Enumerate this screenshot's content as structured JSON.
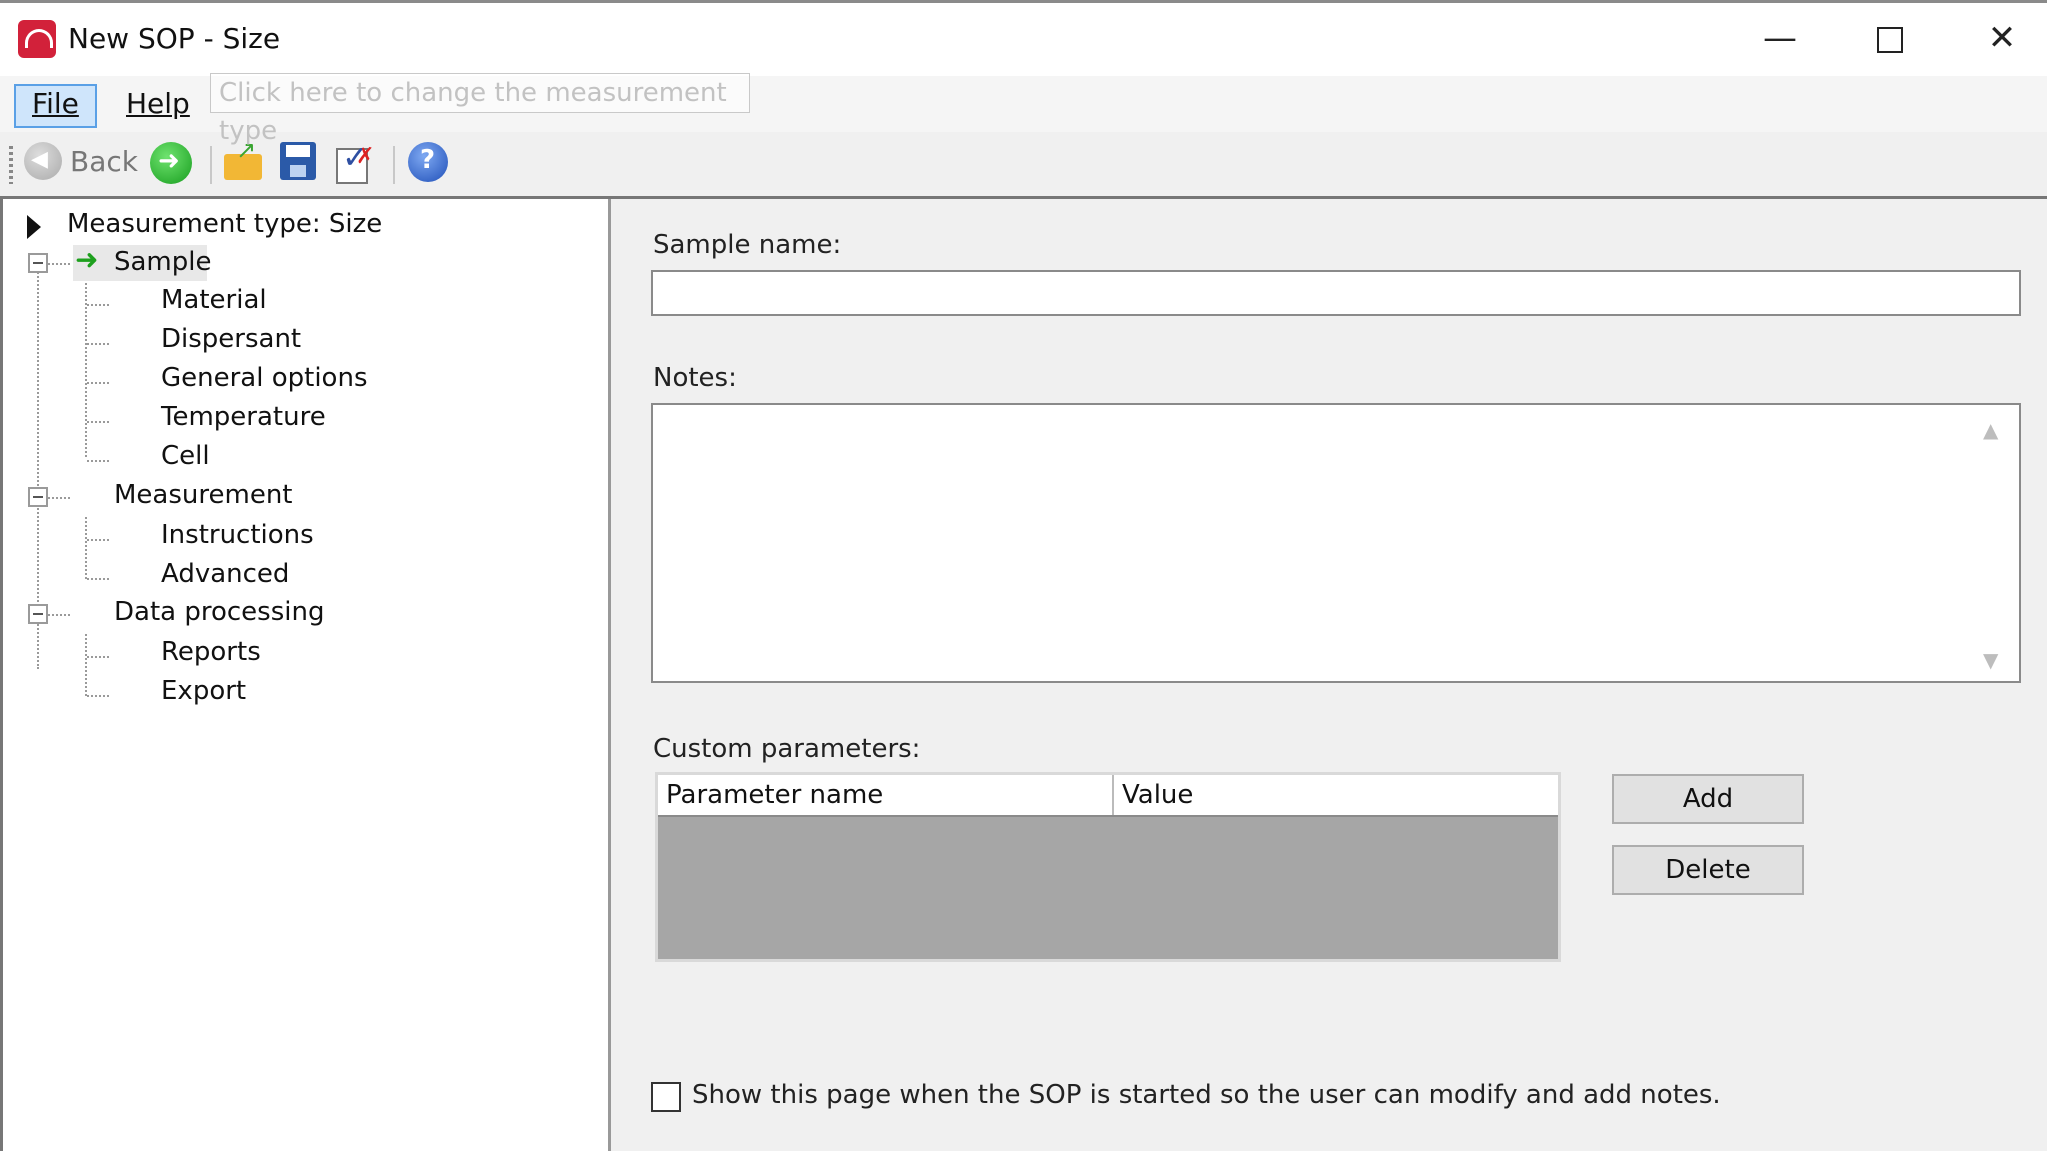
{
  "window": {
    "title": "New SOP - Size",
    "brand_color": "#d2213a"
  },
  "menu": {
    "file": "File",
    "help": "Help"
  },
  "toolbar": {
    "back_label": "Back"
  },
  "tree": {
    "root": "Measurement type: Size",
    "tooltip": "Click here to change the measurement type",
    "groups": [
      {
        "label": "Sample",
        "selected": true,
        "children": [
          "Material",
          "Dispersant",
          "General options",
          "Temperature",
          "Cell"
        ]
      },
      {
        "label": "Measurement",
        "children": [
          "Instructions",
          "Advanced"
        ]
      },
      {
        "label": "Data processing",
        "children": [
          "Reports",
          "Export"
        ]
      }
    ]
  },
  "form": {
    "sample_name_label": "Sample name:",
    "sample_name_value": "",
    "notes_label": "Notes:",
    "notes_value": "",
    "custom_params_label": "Custom parameters:",
    "columns": [
      "Parameter name",
      "Value"
    ],
    "add_button": "Add",
    "delete_button": "Delete",
    "show_page_checkbox": "Show this page when the SOP is started so the user can modify and add notes.",
    "show_page_checked": false
  }
}
